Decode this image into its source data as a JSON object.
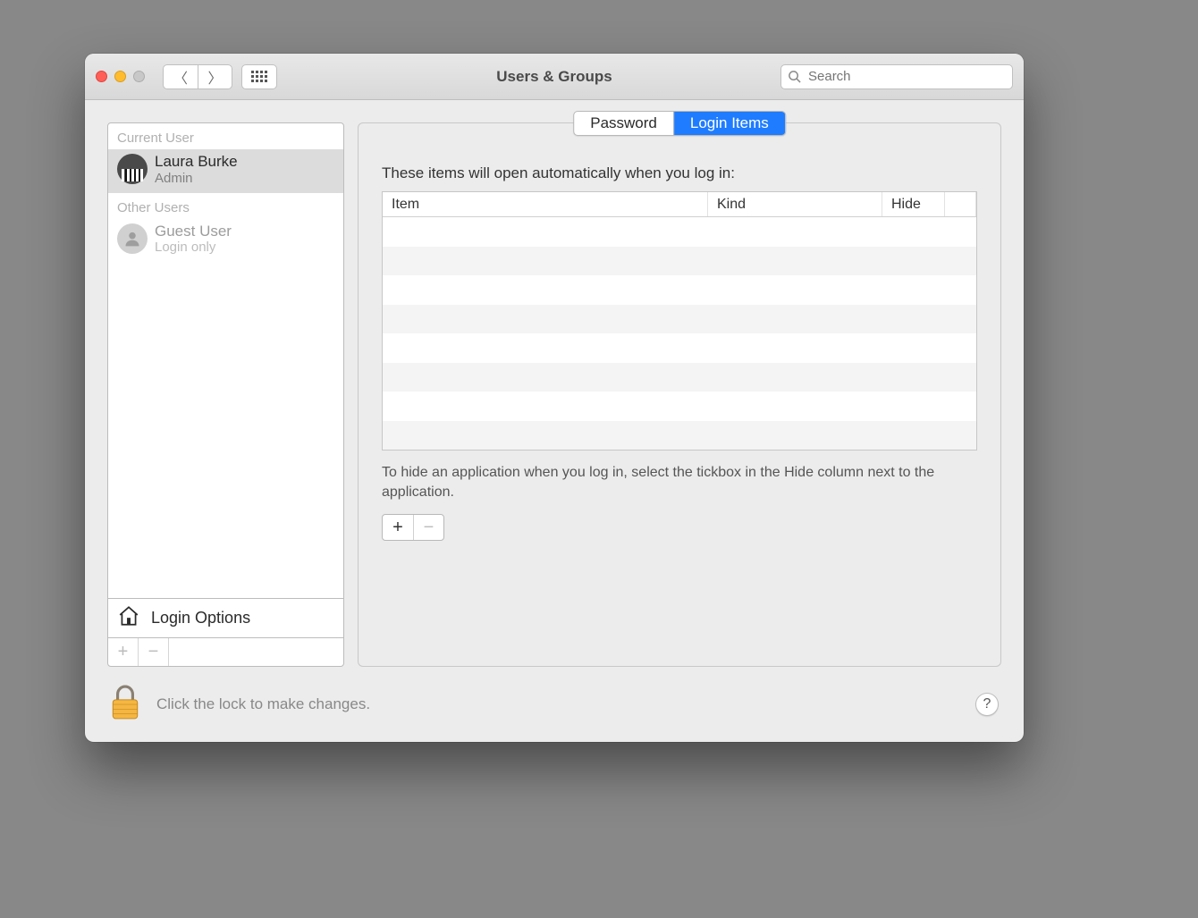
{
  "window": {
    "title": "Users & Groups"
  },
  "search": {
    "placeholder": "Search"
  },
  "sidebar": {
    "section_current": "Current User",
    "section_other": "Other Users",
    "current_user": {
      "name": "Laura Burke",
      "role": "Admin"
    },
    "other_user": {
      "name": "Guest User",
      "role": "Login only"
    },
    "login_options_label": "Login Options"
  },
  "tabs": {
    "password": "Password",
    "login_items": "Login Items"
  },
  "main": {
    "intro": "These items will open automatically when you log in:",
    "col_item": "Item",
    "col_kind": "Kind",
    "col_hide": "Hide",
    "hint": "To hide an application when you log in, select the tickbox in the Hide column next to the application."
  },
  "footer": {
    "lock_text": "Click the lock to make changes.",
    "help_label": "?"
  },
  "glyphs": {
    "plus": "+",
    "minus": "−"
  }
}
